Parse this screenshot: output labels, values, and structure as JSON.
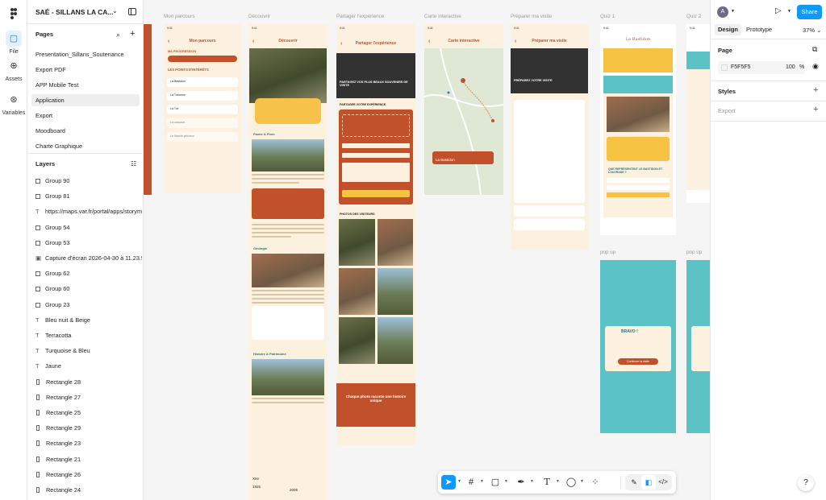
{
  "file": {
    "title": "SAÉ - SILLANS LA CA..."
  },
  "rail": {
    "file": "File",
    "assets": "Assets",
    "variables": "Variables"
  },
  "pages": {
    "title": "Pages",
    "items": [
      "Presentation_Sillans_Soutenance",
      "Export PDF",
      "APP Mobile Test",
      "Application",
      "Export",
      "Moodboard",
      "Charte Graphique"
    ],
    "selected": "Application"
  },
  "layers": {
    "title": "Layers",
    "items": [
      {
        "label": "Group 90",
        "kind": "frame"
      },
      {
        "label": "Group 81",
        "kind": "frame"
      },
      {
        "label": "https://maps.var.fr/portal/apps/storym",
        "kind": "text"
      },
      {
        "label": "Group 54",
        "kind": "frame"
      },
      {
        "label": "Group 53",
        "kind": "frame"
      },
      {
        "label": "Capture d'écran 2026-04-30 à 11.23.5",
        "kind": "image"
      },
      {
        "label": "Group 62",
        "kind": "frame"
      },
      {
        "label": "Group 60",
        "kind": "frame"
      },
      {
        "label": "Group 23",
        "kind": "frame"
      },
      {
        "label": "Bleu nuit & Beige",
        "kind": "text"
      },
      {
        "label": "Terracotta",
        "kind": "text"
      },
      {
        "label": "Turquoise & Bleu",
        "kind": "text"
      },
      {
        "label": "Jaune",
        "kind": "text"
      },
      {
        "label": "Rectangle 28",
        "kind": "rect"
      },
      {
        "label": "Rectangle 27",
        "kind": "rect"
      },
      {
        "label": "Rectangle 25",
        "kind": "rect"
      },
      {
        "label": "Rectangle 29",
        "kind": "rect"
      },
      {
        "label": "Rectangle 23",
        "kind": "rect"
      },
      {
        "label": "Rectangle 21",
        "kind": "rect"
      },
      {
        "label": "Rectangle 26",
        "kind": "rect"
      },
      {
        "label": "Rectangle 24",
        "kind": "rect"
      }
    ]
  },
  "canvas": {
    "frames": [
      "Mon parcours",
      "Découvrir",
      "Partager l'expérience",
      "Carte interactive",
      "Préparer ma visite",
      "Quiz 1",
      "Quiz 2",
      "pop up",
      "pop up"
    ],
    "screens": {
      "parcours": {
        "title": "Mon parcours",
        "progress_label": "MA PROGRESSION",
        "poi_title": "LES POINTS D'INTÉRÊTS",
        "pois": [
          "La Bastidon",
          "La Traverse",
          "La Tuf",
          "La cascade",
          "Le Mamie pêcheur"
        ]
      },
      "decouvrir": {
        "title": "Découvrir",
        "s1": "Faune & Flore",
        "s2": "Géologie",
        "s3": "Histoire & Patrimoine"
      },
      "partager": {
        "title": "Partager l'expérience",
        "hero": "PARTAGEZ VOS PLUS BEAUX SOUVENIRS DE VISITE",
        "form": "PARTAGER VOTRE EXPÉRIENCE",
        "photos": "PHOTOS DES VISITEURS",
        "quote": "Chaque photo raconte une histoire unique"
      },
      "carte": {
        "title": "Carte interactive",
        "place": "La Bastidon"
      },
      "preparer": {
        "title": "Préparer ma visite",
        "hero": "PRÉPAREZ VOTRE VISITE"
      },
      "quiz": {
        "title": "Le Bastidon",
        "question": "QUE REPRÉSENTENT LE BASTIDON ET LOUVRADE ?"
      },
      "popup": {
        "title": "BRAVO !",
        "button": "Continuer la visite"
      }
    },
    "info_year_1": "1925",
    "info_year_2": "2005",
    "info_label": "XIIe"
  },
  "right": {
    "avatar": "A",
    "share": "Share",
    "tabs": [
      "Design",
      "Prototype"
    ],
    "zoom": "37%",
    "page_section": "Page",
    "fill_hex": "F5F5F5",
    "fill_opacity": "100",
    "fill_unit": "%",
    "styles": "Styles",
    "export": "Export",
    "help": "?"
  },
  "colors": {
    "accent": "#0d99ff",
    "terracotta": "#c1512b",
    "beige": "#fbf1de",
    "turquoise": "#5bc2c5",
    "jaune": "#f5c341"
  }
}
